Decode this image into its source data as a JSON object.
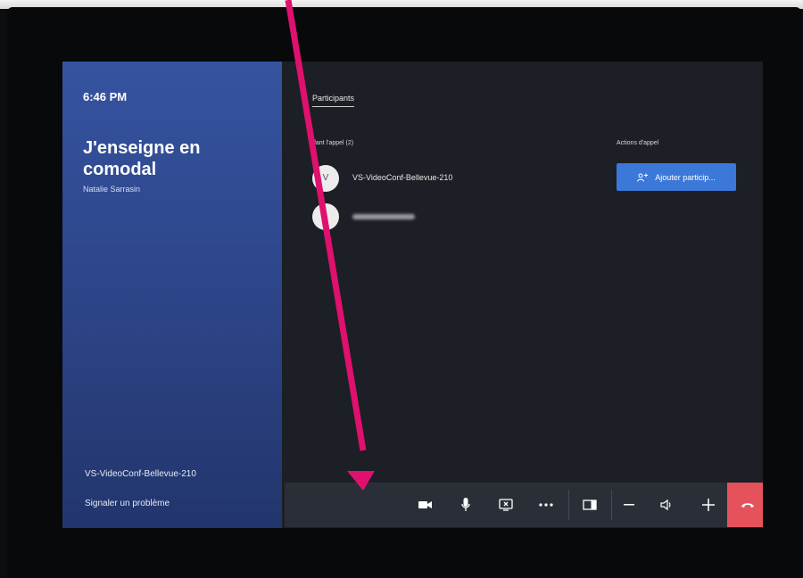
{
  "left_panel": {
    "time": "6:46 PM",
    "meeting_title": "J'enseigne en comodal",
    "organizer": "Natalie Sarrasin",
    "room_name": "VS-VideoConf-Bellevue-210",
    "report_problem": "Signaler un problème"
  },
  "main": {
    "tab_participants": "Participants",
    "in_call_label": "dant l'appel (2)",
    "call_actions_label": "Actions d'appel",
    "add_participant_label": "Ajouter particip...",
    "participants": [
      {
        "avatar_initial": "V",
        "name": "VS-VideoConf-Bellevue-210"
      },
      {
        "avatar_initial": "",
        "name": ""
      }
    ]
  },
  "controls": {
    "icons": [
      "video-camera-icon",
      "microphone-icon",
      "share-screen-icon",
      "more-options-icon",
      "layout-icon",
      "volume-down-icon",
      "speaker-icon",
      "volume-up-icon",
      "hang-up-icon"
    ]
  },
  "colors": {
    "left_panel": "#2f4a92",
    "accent_button": "#3b78d8",
    "end_call": "#e5525c",
    "control_bar": "#2a2f37",
    "annotation_arrow": "#e0106e"
  }
}
